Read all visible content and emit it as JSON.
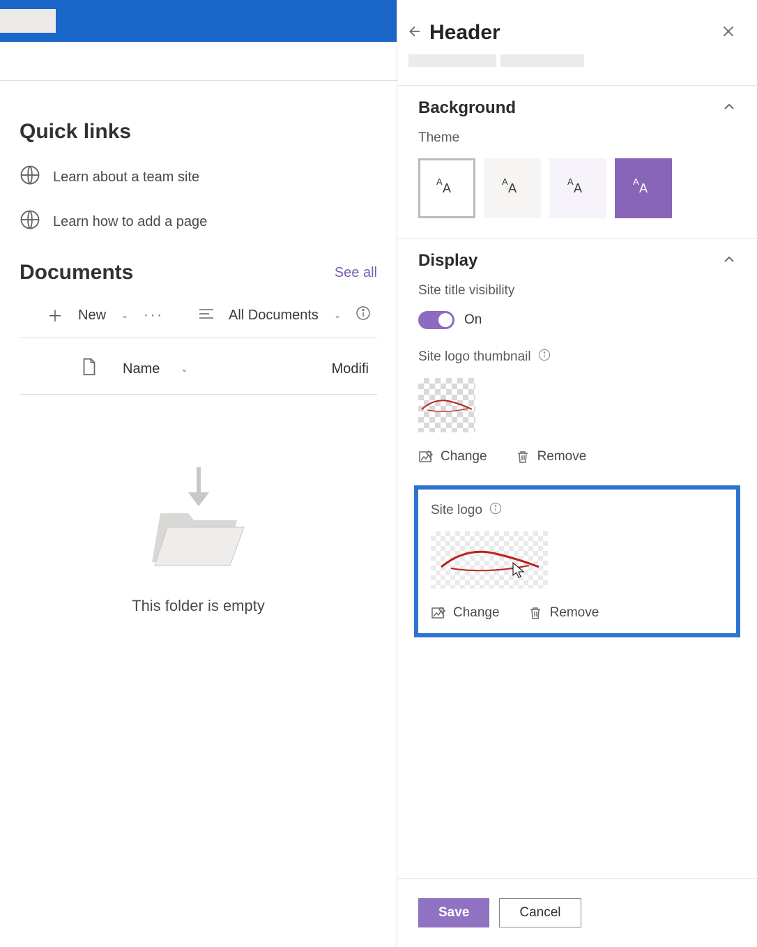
{
  "quicklinks": {
    "title": "Quick links",
    "items": [
      {
        "label": "Learn about a team site"
      },
      {
        "label": "Learn how to add a page"
      }
    ]
  },
  "documents": {
    "title": "Documents",
    "see_all": "See all",
    "toolbar": {
      "new_label": "New",
      "view_label": "All Documents"
    },
    "columns": {
      "name": "Name",
      "modified": "Modifi"
    },
    "empty_message": "This folder is empty"
  },
  "panel": {
    "title": "Header",
    "sections": {
      "background": {
        "title": "Background",
        "theme_label": "Theme"
      },
      "display": {
        "title": "Display",
        "site_title_visibility_label": "Site title visibility",
        "toggle_state": "On",
        "logo_thumb_label": "Site logo thumbnail",
        "site_logo_label": "Site logo",
        "change_label": "Change",
        "remove_label": "Remove"
      }
    },
    "footer": {
      "save": "Save",
      "cancel": "Cancel"
    }
  },
  "colors": {
    "brand_purple": "#8f72c1",
    "highlight_blue": "#2f73d0"
  }
}
